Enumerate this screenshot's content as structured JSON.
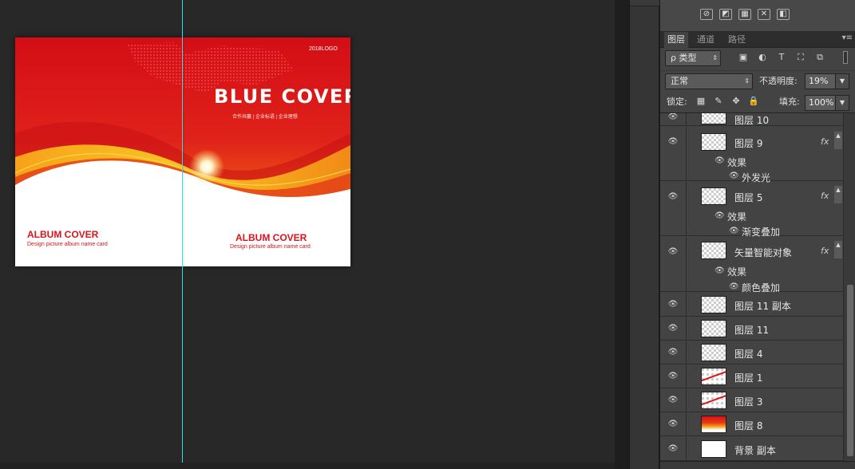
{
  "document": {
    "logo_text": "2018LOGO",
    "headline": "BLUE COVER",
    "tagline": "合作共赢 | 企业标语 | 企业理想",
    "left_title": "ALBUM COVER",
    "left_desc": "Design picture album name card",
    "right_title": "ALBUM COVER",
    "right_desc": "Design picture album name card"
  },
  "panel": {
    "tabs": [
      "图层",
      "通道",
      "路径"
    ],
    "filter_kind": "ρ 类型",
    "blend_mode": "正常",
    "opacity_label": "不透明度:",
    "opacity_value": "19%",
    "lock_label": "锁定:",
    "fill_label": "填充:",
    "fill_value": "100%"
  },
  "layers": [
    {
      "name": "图层 10",
      "thumb": "checker"
    },
    {
      "name": "图层 9",
      "thumb": "checker",
      "fx": "fx",
      "effects_label": "效果",
      "effects": [
        "外发光"
      ]
    },
    {
      "name": "图层 5",
      "thumb": "checker",
      "fx": "fx",
      "effects_label": "效果",
      "effects": [
        "渐变叠加"
      ]
    },
    {
      "name": "矢量智能对象",
      "thumb": "checker",
      "fx": "fx",
      "effects_label": "效果",
      "effects": [
        "颜色叠加"
      ]
    },
    {
      "name": "图层 11 副本",
      "thumb": "checker"
    },
    {
      "name": "图层 11",
      "thumb": "checker"
    },
    {
      "name": "图层 4",
      "thumb": "checker"
    },
    {
      "name": "图层 1",
      "thumb": "line"
    },
    {
      "name": "图层 3",
      "thumb": "line"
    },
    {
      "name": "图层 8",
      "thumb": "gradient"
    },
    {
      "name": "背景 副本",
      "thumb": "white"
    }
  ]
}
